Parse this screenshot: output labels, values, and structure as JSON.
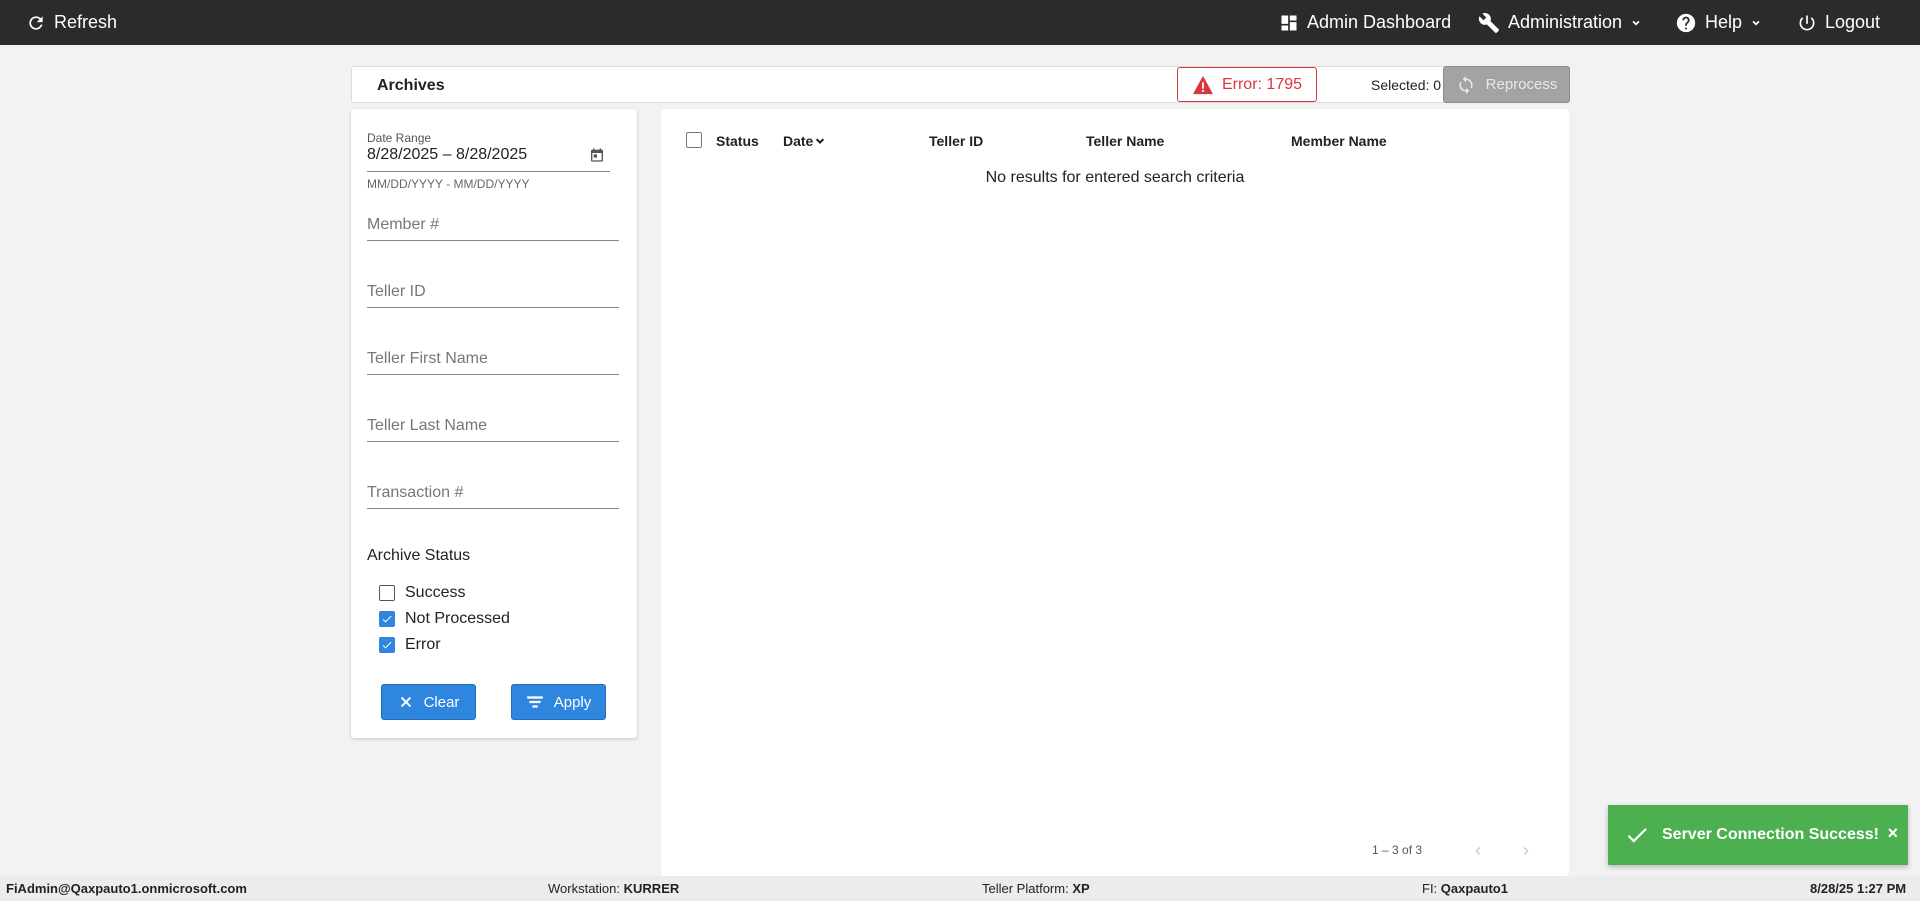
{
  "topbar": {
    "refresh": "Refresh",
    "admin_dashboard": "Admin Dashboard",
    "administration": "Administration",
    "help": "Help",
    "logout": "Logout"
  },
  "header": {
    "title": "Archives",
    "error_badge": "Error: 1795",
    "selected": "Selected: 0",
    "reprocess": "Reprocess"
  },
  "filters": {
    "date_range_label": "Date Range",
    "date_range_value": "8/28/2025 – 8/28/2025",
    "date_range_hint": "MM/DD/YYYY - MM/DD/YYYY",
    "member_placeholder": "Member #",
    "teller_id_placeholder": "Teller ID",
    "teller_first_placeholder": "Teller First Name",
    "teller_last_placeholder": "Teller Last Name",
    "transaction_placeholder": "Transaction #",
    "archive_status_title": "Archive Status",
    "statuses": [
      {
        "label": "Success",
        "checked": false
      },
      {
        "label": "Not Processed",
        "checked": true
      },
      {
        "label": "Error",
        "checked": true
      }
    ],
    "clear": "Clear",
    "apply": "Apply"
  },
  "table": {
    "columns": [
      "Status",
      "Date",
      "Teller ID",
      "Teller Name",
      "Member Name"
    ],
    "empty_message": "No results for entered search criteria",
    "pager": "1 – 3 of 3"
  },
  "statusbar": {
    "user": "FiAdmin@Qaxpauto1.onmicrosoft.com",
    "workstation_label": "Workstation:",
    "workstation_value": "KURRER",
    "platform_label": "Teller Platform:",
    "platform_value": "XP",
    "fi_label": "FI:",
    "fi_value": "Qaxpauto1",
    "datetime": "8/28/25 1:27 PM"
  },
  "toast": {
    "message": "Server Connection Success!",
    "close": "×"
  },
  "colors": {
    "nav_bg": "#2b2b2b",
    "primary": "#2e86de",
    "error": "#d9363e",
    "success_toast": "#4caf50"
  }
}
